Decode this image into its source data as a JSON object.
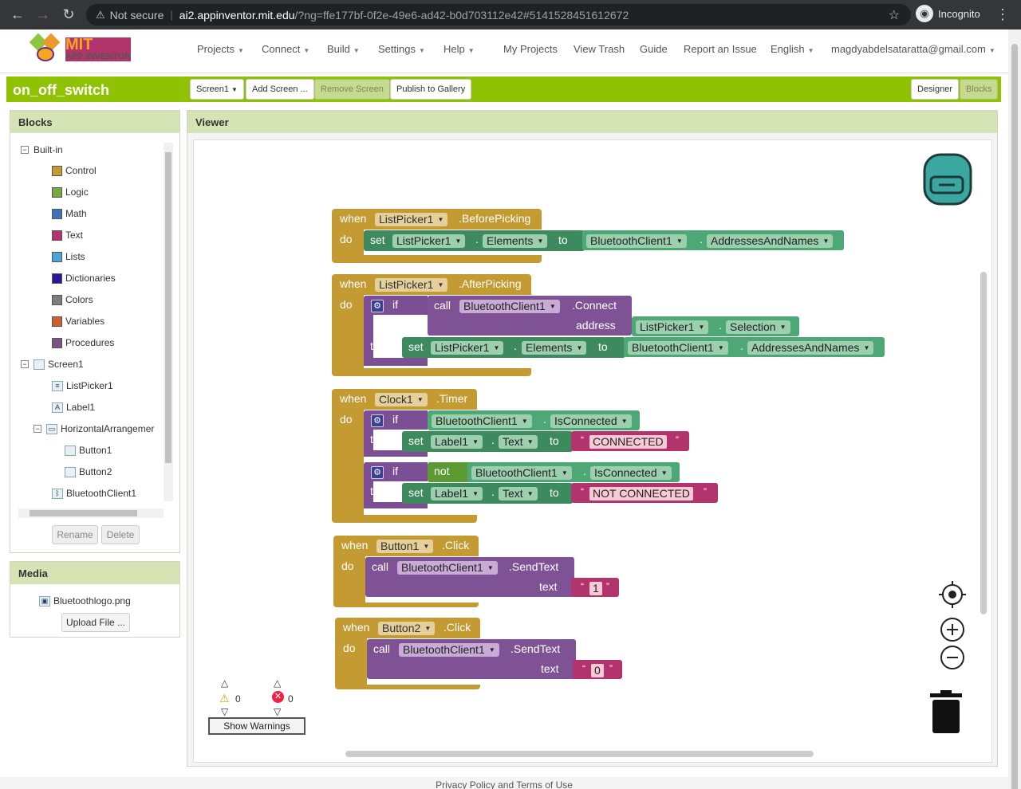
{
  "browser": {
    "security": "Not secure",
    "url_host": "ai2.appinventor.mit.edu",
    "url_path": "/?ng=ffe177bf-0f2e-49e6-ad42-b0d703112e42#5141528451612672",
    "profile": "Incognito"
  },
  "app": {
    "logo_mit": "MIT",
    "logo_sub": "APP INVENTOR",
    "menus": [
      "Projects",
      "Connect",
      "Build",
      "Settings",
      "Help"
    ],
    "links": [
      "My Projects",
      "View Trash",
      "Guide",
      "Report an Issue",
      "English"
    ],
    "user": "magdyabdelsataratta@gmail.com"
  },
  "project": {
    "name": "on_off_switch",
    "screen_selector": "Screen1",
    "add_screen": "Add Screen ...",
    "remove_screen": "Remove Screen",
    "publish": "Publish to Gallery",
    "designer": "Designer",
    "blocks": "Blocks"
  },
  "blocks_panel": {
    "title": "Blocks",
    "builtin_label": "Built-in",
    "builtin": [
      {
        "label": "Control",
        "color": "#c49a32"
      },
      {
        "label": "Logic",
        "color": "#77ab41"
      },
      {
        "label": "Math",
        "color": "#3f71b5"
      },
      {
        "label": "Text",
        "color": "#b3346d"
      },
      {
        "label": "Lists",
        "color": "#49a6d4"
      },
      {
        "label": "Dictionaries",
        "color": "#2d1799"
      },
      {
        "label": "Colors",
        "color": "#7d7d7d"
      },
      {
        "label": "Variables",
        "color": "#d05f2d"
      },
      {
        "label": "Procedures",
        "color": "#7c5385"
      }
    ],
    "screen_label": "Screen1",
    "components": [
      "ListPicker1",
      "Label1",
      "HorizontalArrangemer",
      "Button1",
      "Button2",
      "BluetoothClient1"
    ],
    "rename": "Rename",
    "delete": "Delete"
  },
  "media": {
    "title": "Media",
    "file": "Bluetoothlogo.png",
    "upload": "Upload File ..."
  },
  "viewer": {
    "title": "Viewer",
    "warnings_count": "0",
    "errors_count": "0",
    "show_warnings": "Show Warnings"
  },
  "code": {
    "kw_when": "when",
    "kw_do": "do",
    "kw_set": "set",
    "kw_to": "to",
    "kw_call": "call",
    "kw_if": "if",
    "kw_then": "then",
    "kw_not": "not",
    "kw_address": "address",
    "kw_text": "text",
    "listpicker": "ListPicker1",
    "bt": "BluetoothClient1",
    "clock": "Clock1",
    "label": "Label1",
    "button1": "Button1",
    "button2": "Button2",
    "ev_before": ".BeforePicking",
    "ev_after": ".AfterPicking",
    "ev_timer": ".Timer",
    "ev_click": ".Click",
    "m_connect": ".Connect",
    "m_send": ".SendText",
    "p_elements": "Elements",
    "p_addr": "AddressesAndNames",
    "p_selection": "Selection",
    "p_isconnected": "IsConnected",
    "p_text": "Text",
    "s_connected": "CONNECTED",
    "s_notconnected": "NOT CONNECTED",
    "s_one": "1",
    "s_zero": "0"
  },
  "footer": "Privacy Policy and Terms of Use"
}
